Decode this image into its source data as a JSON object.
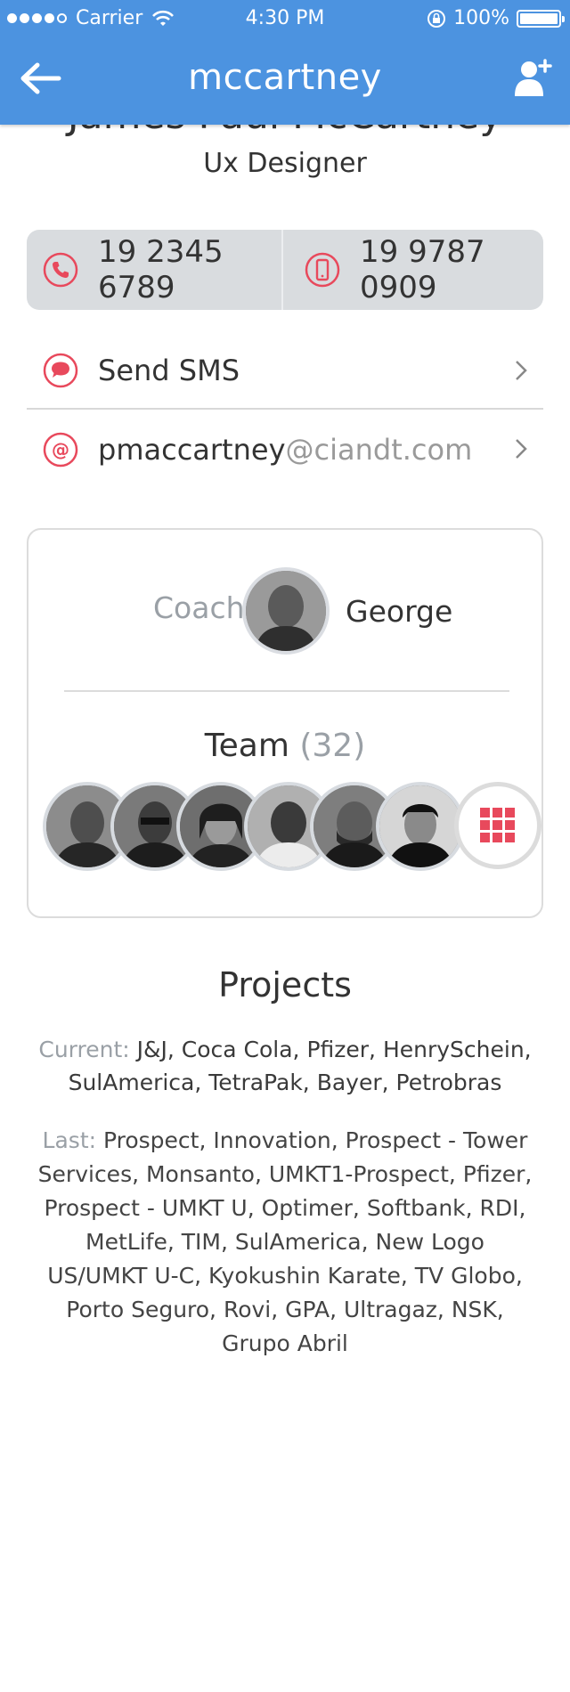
{
  "status_bar": {
    "carrier": "Carrier",
    "time": "4:30 PM",
    "battery": "100%",
    "signal_dots": 5,
    "signal_filled": 4
  },
  "nav": {
    "title": "mccartney",
    "back_icon": "arrow-left-icon",
    "add_icon": "add-user-icon"
  },
  "profile": {
    "full_name": "James Paul McCartney",
    "job_title": "Ux Designer"
  },
  "phones": [
    {
      "number": "19 2345 6789",
      "icon": "phone-icon"
    },
    {
      "number": "19 9787 0909",
      "icon": "mobile-icon"
    }
  ],
  "contact": {
    "sms_label": "Send SMS",
    "email_user": "pmaccartney",
    "email_domain": "@ciandt.com"
  },
  "coach": {
    "label": "Coach",
    "name": "George"
  },
  "team": {
    "label": "Team",
    "count": "(32)",
    "members_shown": 6
  },
  "projects": {
    "title": "Projects",
    "current_label": "Current:",
    "current_list": "J&J, Coca Cola, Pfizer, HenrySchein, SulAmerica, TetraPak, Bayer, Petrobras",
    "last_label": "Last:",
    "last_list": "Prospect, Innovation, Prospect - Tower Services, Monsanto, UMKT1-Prospect, Pfizer, Prospect - UMKT U, Optimer, Softbank, RDI, MetLife, TIM, SulAmerica, New Logo US/UMKT U-C, Kyokushin Karate, TV Globo, Porto Seguro, Rovi, GPA, Ultragaz, NSK, Grupo Abril"
  },
  "colors": {
    "header": "#4c93e0",
    "accent": "#e8495c",
    "muted_text": "#9aa0a6",
    "phone_bg": "#d9dcdf"
  }
}
